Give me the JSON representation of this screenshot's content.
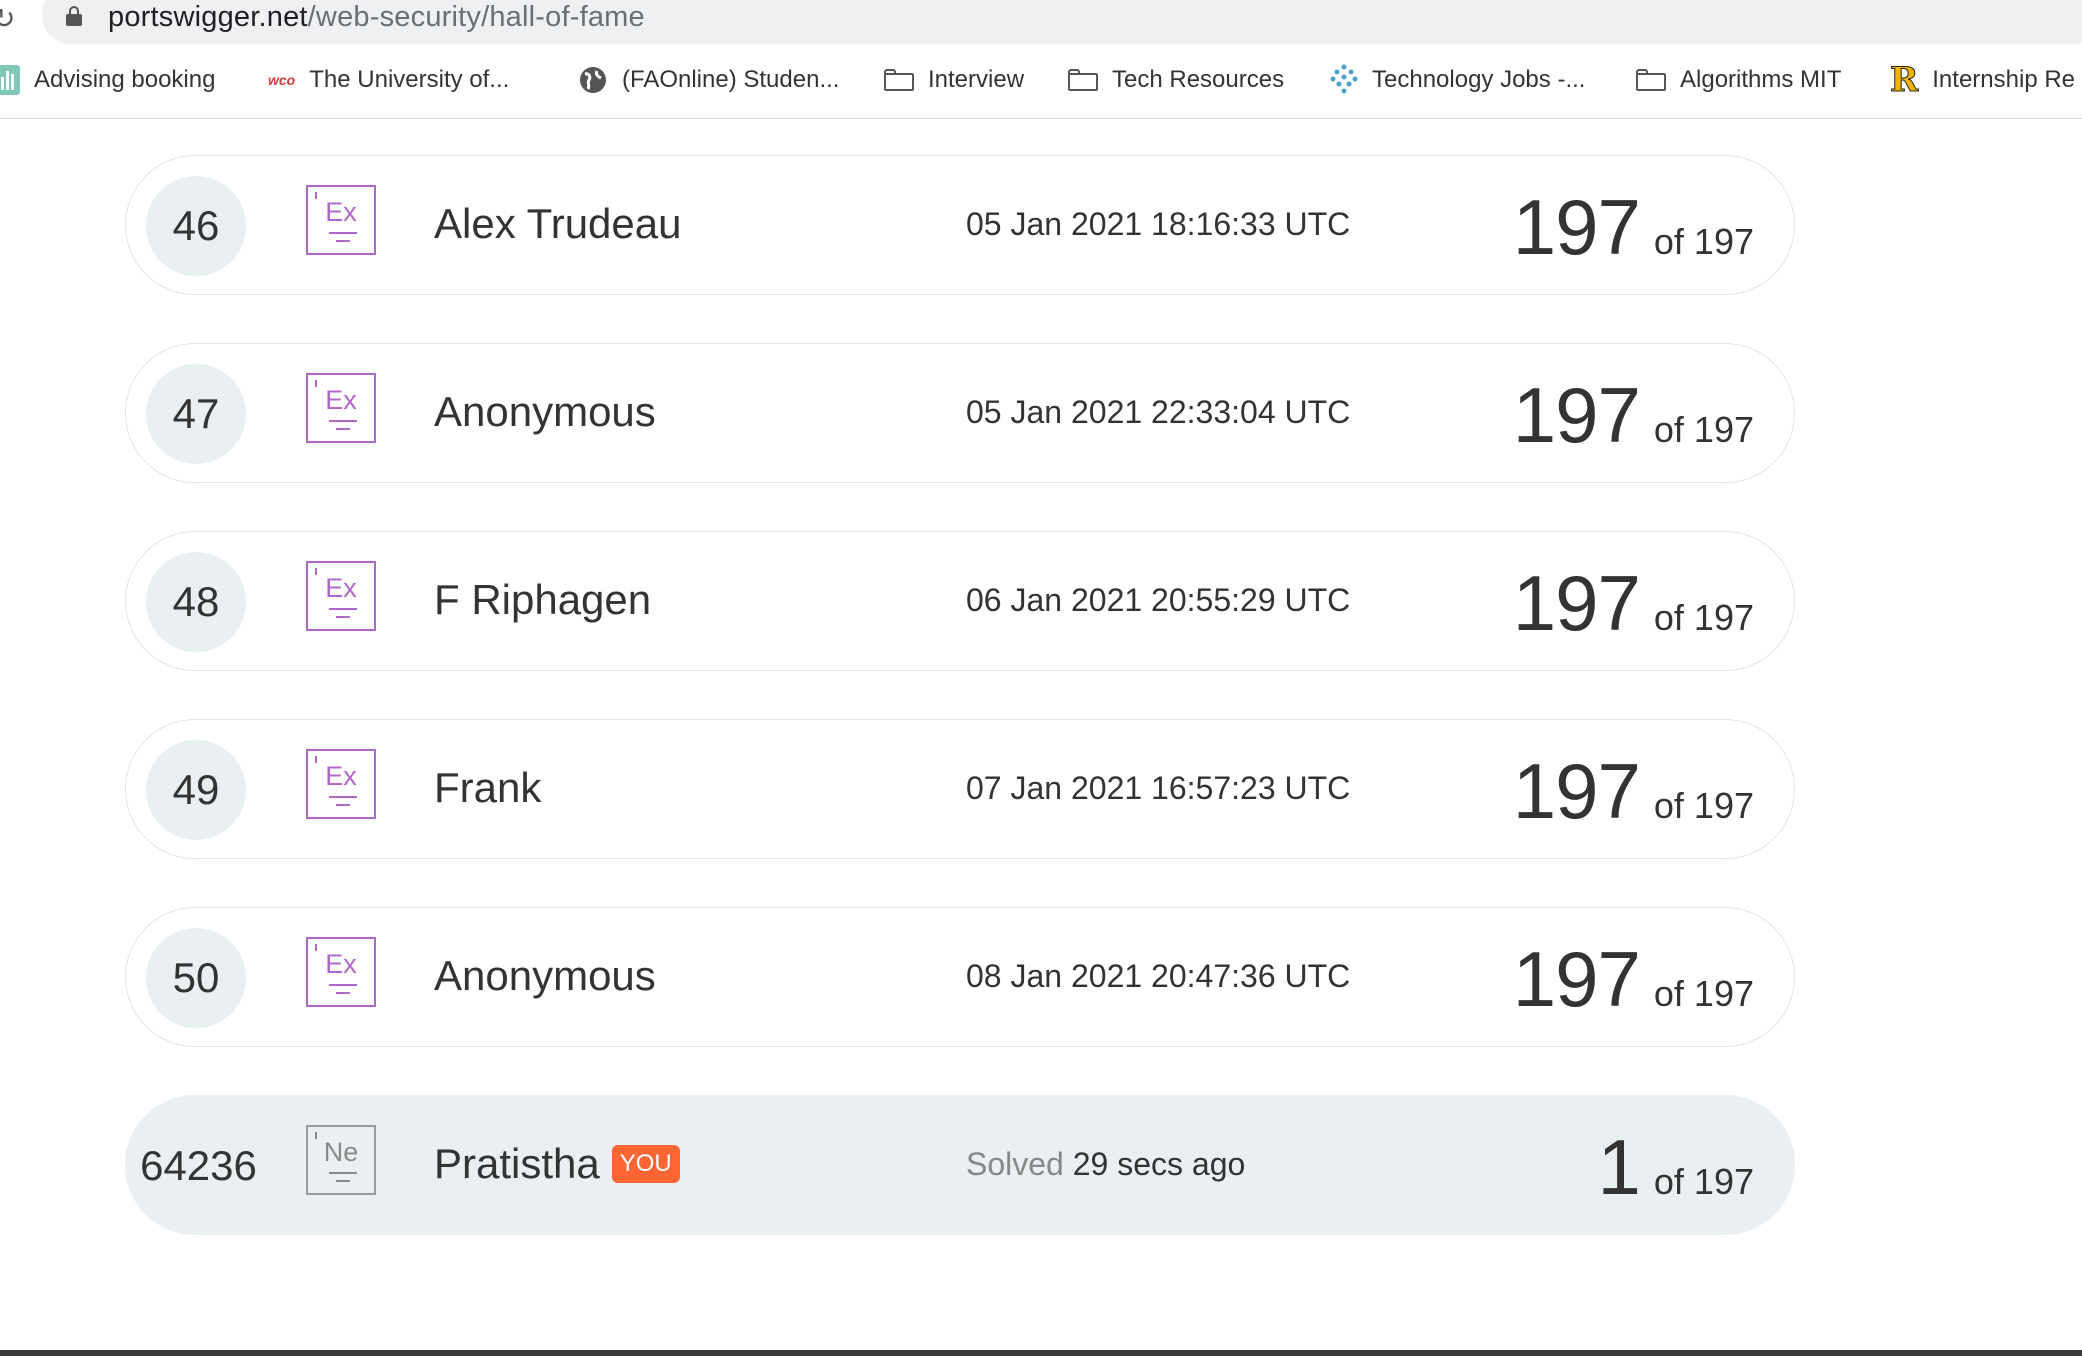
{
  "browser": {
    "url_host": "portswigger.net",
    "url_path": "/web-security/hall-of-fame"
  },
  "bookmarks": [
    {
      "label": "Advising booking",
      "icon": "chart-bars-icon"
    },
    {
      "label": "The University of...",
      "icon": "wco-logo-icon"
    },
    {
      "label": "(FAOnline) Studen...",
      "icon": "globe-icon"
    },
    {
      "label": "Interview",
      "icon": "folder-icon"
    },
    {
      "label": "Tech Resources",
      "icon": "folder-icon"
    },
    {
      "label": "Technology Jobs -...",
      "icon": "dots-tree-icon"
    },
    {
      "label": "Algorithms MIT",
      "icon": "folder-icon"
    },
    {
      "label": "Internship Re",
      "icon": "r-logo-icon"
    }
  ],
  "leaderboard": {
    "rows": [
      {
        "rank": "46",
        "badge": "Ex",
        "name": "Alex Trudeau",
        "date": "05 Jan 2021 18:16:33 UTC",
        "score": "197",
        "of": "of 197"
      },
      {
        "rank": "47",
        "badge": "Ex",
        "name": "Anonymous",
        "date": "05 Jan 2021 22:33:04 UTC",
        "score": "197",
        "of": "of 197"
      },
      {
        "rank": "48",
        "badge": "Ex",
        "name": "F Riphagen",
        "date": "06 Jan 2021 20:55:29 UTC",
        "score": "197",
        "of": "of 197"
      },
      {
        "rank": "49",
        "badge": "Ex",
        "name": "Frank",
        "date": "07 Jan 2021 16:57:23 UTC",
        "score": "197",
        "of": "of 197"
      },
      {
        "rank": "50",
        "badge": "Ex",
        "name": "Anonymous",
        "date": "08 Jan 2021 20:47:36 UTC",
        "score": "197",
        "of": "of 197"
      }
    ],
    "you": {
      "rank": "64236",
      "badge": "Ne",
      "name": "Pratistha",
      "tag": "YOU",
      "solved_label": "Solved",
      "solved_time": "29 secs ago",
      "score": "1",
      "of": "of 197"
    }
  },
  "colors": {
    "expert_badge": "#b067c8",
    "novice_badge": "#8a8a8a",
    "you_tag": "#ff6633",
    "you_row_bg": "#eaeff2"
  }
}
